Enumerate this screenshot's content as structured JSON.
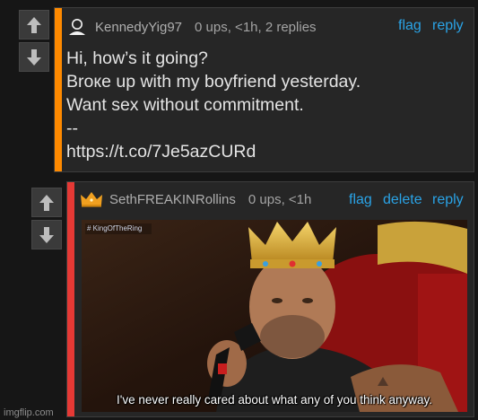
{
  "comments": [
    {
      "username": "KennedyYig97",
      "stats": "0 ups, <1h, 2 replies",
      "actions": {
        "flag": "flag",
        "reply": "reply"
      },
      "body_lines": [
        "Hi, how’s it going?",
        "Brоке up with my boyfriend yesterday.",
        "Want sex without commitment.",
        "--",
        "https://t.co/7Je5azCURd"
      ],
      "accent_color": "#ff8a00"
    },
    {
      "username": "SethFREAKINRollins",
      "stats": "0 ups, <1h",
      "actions": {
        "flag": "flag",
        "delete": "delete",
        "reply": "reply"
      },
      "image": {
        "hashtag": "# KingOfTheRing",
        "caption": "I've never really cared about what any of you think anyway."
      },
      "accent_color": "#e53935"
    }
  ],
  "watermark": "imgflip.com",
  "colors": {
    "link": "#2aa3e6",
    "background": "#161616",
    "panel": "#262626"
  },
  "icons": {
    "upvote": "upvote-arrow-icon",
    "downvote": "downvote-arrow-icon",
    "avatar": "user-avatar-icon",
    "crown": "crown-icon"
  }
}
